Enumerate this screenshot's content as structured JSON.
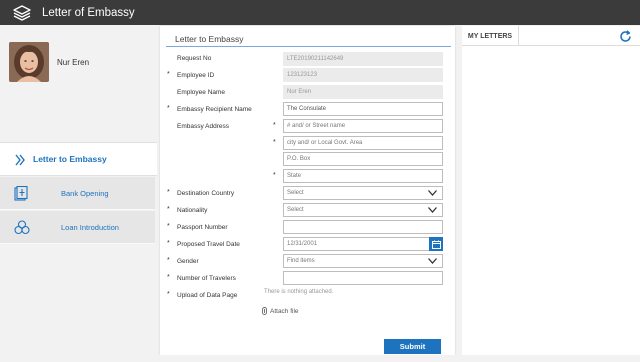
{
  "app": {
    "title": "Letter of Embassy"
  },
  "profile": {
    "name": "Nur Eren"
  },
  "nav": {
    "active_label": "Letter to Embassy",
    "items": [
      {
        "label": "Bank Opening"
      },
      {
        "label": "Loan Introduction"
      }
    ]
  },
  "form": {
    "title": "Letter to Embassy",
    "fields": {
      "request_no": {
        "label": "Request No",
        "value": "LTE20190211142649"
      },
      "employee_id": {
        "label": "Employee ID",
        "value": "123123123"
      },
      "employee_name": {
        "label": "Employee Name",
        "value": "Nur Eren"
      },
      "embassy_recipient": {
        "label": "Embassy Recipient Name",
        "value": "The Consulate"
      },
      "embassy_address": {
        "label": "Embassy Address",
        "street_placeholder": "# and/ or Street name",
        "city_placeholder": "city and/ or Local Govt. Area",
        "pobox_placeholder": "P.O. Box",
        "state_placeholder": "State"
      },
      "destination_country": {
        "label": "Destination Country",
        "value": "Select"
      },
      "nationality": {
        "label": "Nationality",
        "value": "Select"
      },
      "passport_number": {
        "label": "Passport Number",
        "value": ""
      },
      "proposed_travel_date": {
        "label": "Proposed Travel Date",
        "value": "12/31/2001"
      },
      "gender": {
        "label": "Gender",
        "value": "Find items"
      },
      "number_of_travelers": {
        "label": "Number of Travelers",
        "value": ""
      },
      "upload_data_page": {
        "label": "Upload of Data Page",
        "note": "There is nothing attached."
      }
    },
    "attach_label": "Attach file",
    "required_mark": "*",
    "submit_label": "Submit"
  },
  "letters": {
    "tab_label": "MY LETTERS"
  },
  "colors": {
    "accent": "#1e73be",
    "topbar": "#3b3b3b",
    "sidebar": "#f2f2f2"
  },
  "icons": {
    "app_logo": "stack-layers-icon",
    "letter_nav": "chevrons-right-icon",
    "bank_nav": "bank-document-icon",
    "loan_nav": "coins-icon",
    "dropdown": "chevron-down-icon",
    "calendar": "calendar-icon",
    "attach": "paperclip-icon",
    "refresh": "refresh-icon"
  }
}
